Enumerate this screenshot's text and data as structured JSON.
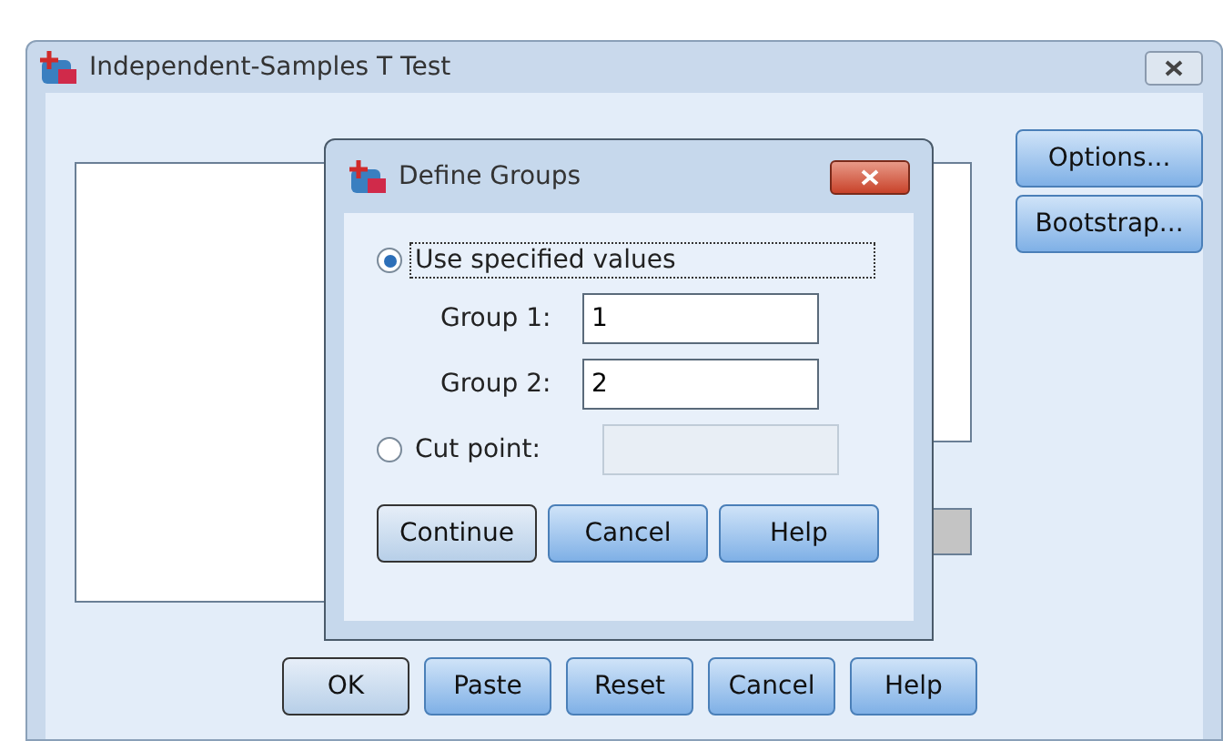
{
  "window": {
    "title": "Independent-Samples T Test"
  },
  "side_buttons": [
    {
      "label": "Options..."
    },
    {
      "label": "Bootstrap..."
    }
  ],
  "buttons": [
    {
      "label": "OK",
      "default": true
    },
    {
      "label": "Paste",
      "default": false
    },
    {
      "label": "Reset",
      "default": false
    },
    {
      "label": "Cancel",
      "default": false
    },
    {
      "label": "Help",
      "default": false
    }
  ],
  "dialog": {
    "title": "Define Groups",
    "specified": {
      "label": "Use specified values",
      "selected": true,
      "focused": true
    },
    "groups": [
      {
        "label": "Group 1:",
        "value": "1"
      },
      {
        "label": "Group 2:",
        "value": "2"
      }
    ],
    "cut_point": {
      "label": "Cut point:",
      "selected": false,
      "disabled": true
    },
    "buttons": [
      {
        "label": "Continue",
        "default": true
      },
      {
        "label": "Cancel",
        "default": false
      },
      {
        "label": "Help",
        "default": false
      }
    ]
  }
}
